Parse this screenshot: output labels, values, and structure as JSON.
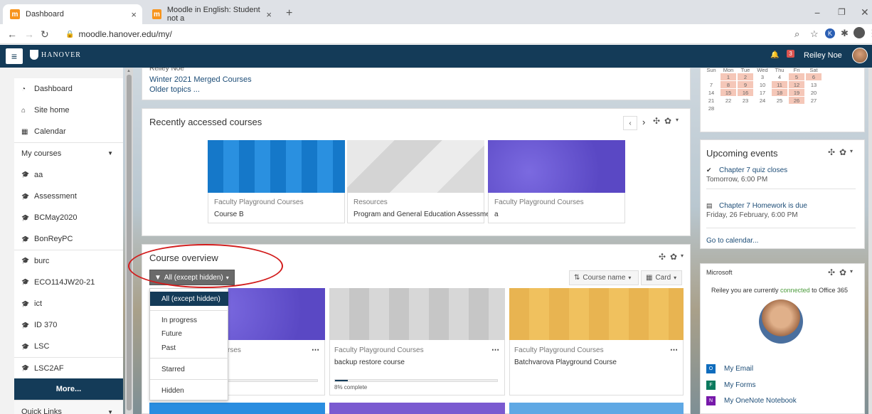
{
  "browser": {
    "tab1": "Dashboard",
    "tab2": "Moodle in English: Student not a",
    "url": "moodle.hanover.edu/my/",
    "new_tab": "+"
  },
  "nav": {
    "logo": "HANOVER",
    "notif_count": "3",
    "user": "Reiley Noe"
  },
  "drawer": {
    "items": [
      {
        "label": "Dashboard",
        "icon": "tachometer-icon"
      },
      {
        "label": "Site home",
        "icon": "home-icon"
      },
      {
        "label": "Calendar",
        "icon": "calendar-icon"
      },
      {
        "label": "My courses",
        "icon": ""
      },
      {
        "label": "aa",
        "icon": "graduation-cap-icon"
      },
      {
        "label": "Assessment",
        "icon": "graduation-cap-icon"
      },
      {
        "label": "BCMay2020",
        "icon": "graduation-cap-icon"
      },
      {
        "label": "BonReyPC",
        "icon": "graduation-cap-icon"
      },
      {
        "label": "burc",
        "icon": "graduation-cap-icon"
      },
      {
        "label": "ECO114JW20-21",
        "icon": "graduation-cap-icon"
      },
      {
        "label": "ict",
        "icon": "graduation-cap-icon"
      },
      {
        "label": "ID 370",
        "icon": "graduation-cap-icon"
      },
      {
        "label": "LSC",
        "icon": "graduation-cap-icon"
      },
      {
        "label": "LSC2AF",
        "icon": "graduation-cap-icon"
      }
    ],
    "more": "More...",
    "quick_links": "Quick Links"
  },
  "top_block": {
    "line1": "Reiley Noe",
    "line2": "Winter 2021 Merged Courses",
    "line3": "Older topics ..."
  },
  "recent": {
    "title": "Recently accessed courses",
    "courses": [
      {
        "category": "Faculty Playground Courses",
        "name": "Course B",
        "color": "#1a86d6"
      },
      {
        "category": "Resources",
        "name": "Program and General Education Assessmen",
        "color": "#d9d9d9"
      },
      {
        "category": "Faculty Playground Courses",
        "name": "a",
        "color": "#6a5acd"
      }
    ]
  },
  "overview": {
    "title": "Course overview",
    "filter": "All (except hidden)",
    "sort": "Course name",
    "view": "Card",
    "menu": [
      "All (except hidden)",
      "In progress",
      "Future",
      "Past",
      "Starred",
      "Hidden"
    ],
    "courses": [
      {
        "category": "rses",
        "name": "",
        "progress": ""
      },
      {
        "category": "Faculty Playground Courses",
        "name": "backup restore course",
        "progress": "8% complete",
        "progress_value": 0.08
      },
      {
        "category": "Faculty Playground Courses",
        "name": "Batchvarova Playground Course",
        "progress": ""
      }
    ]
  },
  "calendar": {
    "header": [
      "Sun",
      "Mon",
      "Tue",
      "Wed",
      "Thu",
      "Fri",
      "Sat"
    ],
    "rows": [
      [
        "",
        "1",
        "2",
        "3",
        "4",
        "5",
        "6"
      ],
      [
        "7",
        "8",
        "9",
        "10",
        "11",
        "12",
        "13"
      ],
      [
        "14",
        "15",
        "16",
        "17",
        "18",
        "19",
        "20"
      ],
      [
        "21",
        "22",
        "23",
        "24",
        "25",
        "26",
        "27"
      ],
      [
        "28",
        "",
        "",
        "",
        "",
        "",
        ""
      ]
    ]
  },
  "upcoming": {
    "title": "Upcoming events",
    "events": [
      {
        "name": "Chapter 7 quiz closes",
        "when": "Tomorrow, 6:00 PM"
      },
      {
        "name": "Chapter 7 Homework is due",
        "when": "Friday, 26 February, 6:00 PM"
      }
    ],
    "link": "Go to calendar..."
  },
  "microsoft": {
    "title": "Microsoft",
    "msg_pre": "Reiley you are currently ",
    "msg_link": "connected",
    "msg_post": " to Office 365",
    "links": [
      "My Email",
      "My Forms",
      "My OneNote Notebook"
    ]
  }
}
